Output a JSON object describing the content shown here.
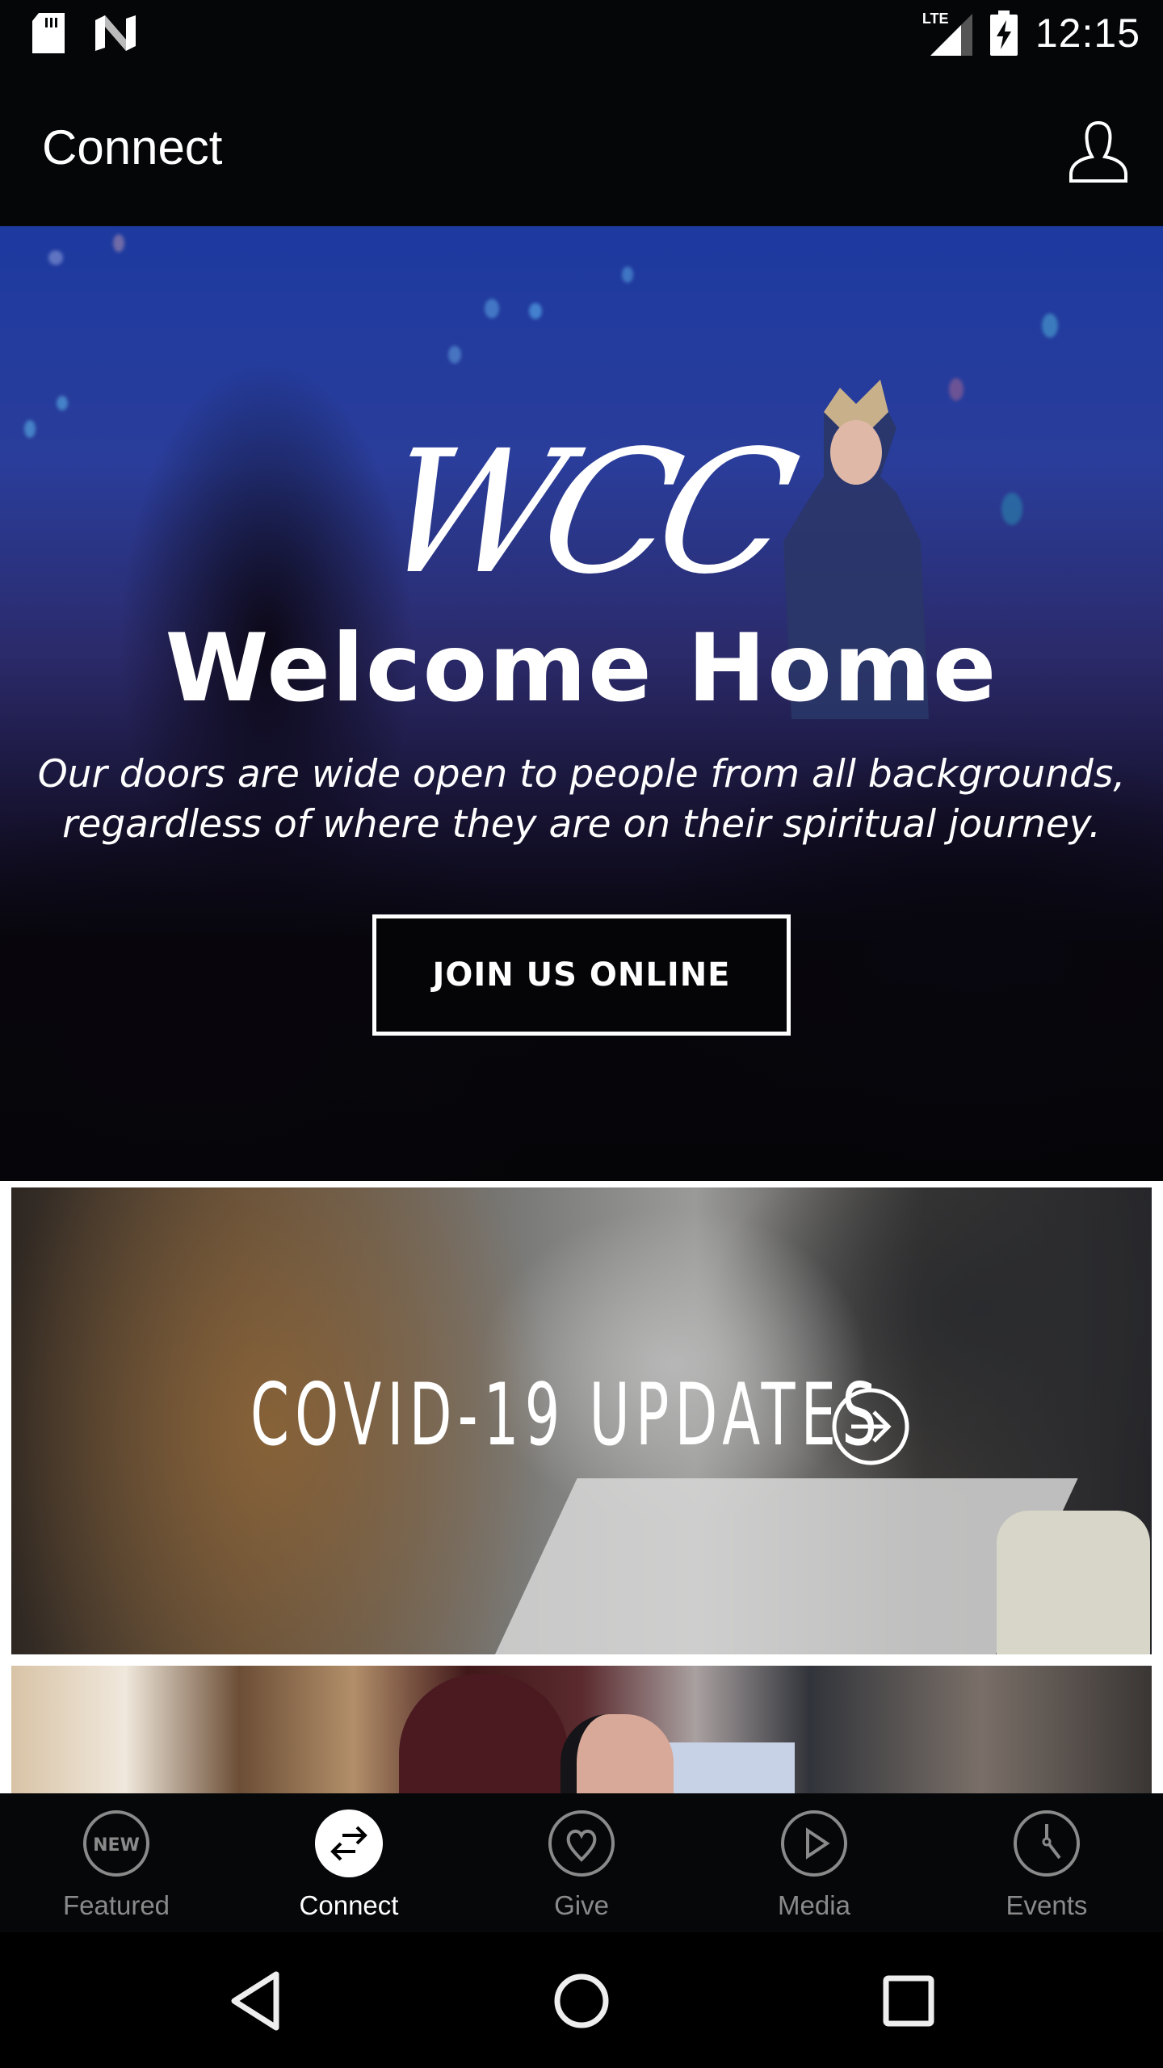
{
  "status_bar": {
    "time": "12:15",
    "network_label": "LTE",
    "left_icons": [
      "sd-card-icon",
      "n-notification-icon"
    ],
    "right_icons": [
      "lte-signal-icon",
      "battery-charging-icon"
    ]
  },
  "app_bar": {
    "title": "Connect",
    "profile_icon": "person-icon"
  },
  "hero": {
    "logo_text": "WCC",
    "title": "Welcome Home",
    "subtitle_line1": "Our doors are wide open to people from all backgrounds,",
    "subtitle_line2": "regardless of where they are on their spiritual journey.",
    "button_label": "JOIN US ONLINE"
  },
  "cards": [
    {
      "title": "COVID-19 UPDATES",
      "icon": "arrow-right-circle-icon"
    },
    {
      "title": ""
    }
  ],
  "tab_bar": {
    "active": "Connect",
    "tabs": [
      {
        "label": "Featured",
        "icon": "new-badge-icon",
        "badge_text": "NEW"
      },
      {
        "label": "Connect",
        "icon": "swap-arrows-icon"
      },
      {
        "label": "Give",
        "icon": "heart-icon"
      },
      {
        "label": "Media",
        "icon": "play-icon"
      },
      {
        "label": "Events",
        "icon": "clock-icon"
      }
    ]
  },
  "nav_bar": {
    "buttons": [
      "back",
      "home",
      "recents"
    ]
  },
  "colors": {
    "bar_background": "#050608",
    "tab_inactive": "#8a8a8a",
    "tab_active": "#ffffff"
  }
}
